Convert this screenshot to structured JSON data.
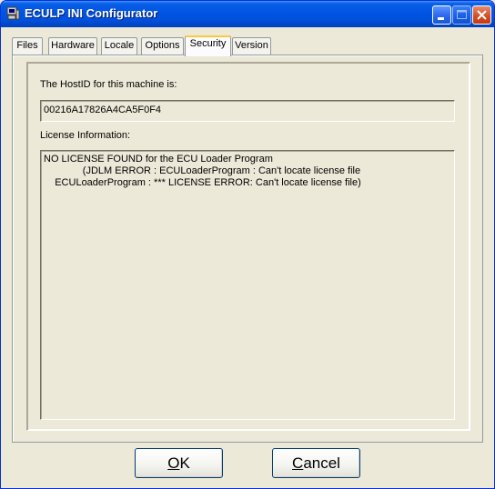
{
  "window": {
    "title": "ECULP INI Configurator"
  },
  "tabs": [
    {
      "label": "Files",
      "active": false
    },
    {
      "label": "Hardware",
      "active": false
    },
    {
      "label": "Locale",
      "active": false
    },
    {
      "label": "Options",
      "active": false
    },
    {
      "label": "Security",
      "active": true
    },
    {
      "label": "Version",
      "active": false
    }
  ],
  "security": {
    "hostid_label": "The HostID for this machine is:",
    "hostid_value": "00216A17826A4CA5F0F4",
    "license_label": "License Information:",
    "license_lines": [
      "NO LICENSE FOUND for the ECU Loader Program",
      "              (JDLM ERROR : ECULoaderProgram : Can't locate license file",
      "    ECULoaderProgram : *** LICENSE ERROR: Can't locate license file)"
    ]
  },
  "buttons": {
    "ok_mnemonic": "O",
    "ok_rest": "K",
    "cancel_mnemonic": "C",
    "cancel_rest": "ancel"
  },
  "icons": {
    "app": "computer-icon",
    "minimize": "minimize-icon",
    "maximize": "maximize-icon",
    "close": "close-icon"
  },
  "colors": {
    "titlebar": "#0054e3",
    "face": "#ece9d8",
    "active_tab_highlight": "#ffc83c"
  }
}
